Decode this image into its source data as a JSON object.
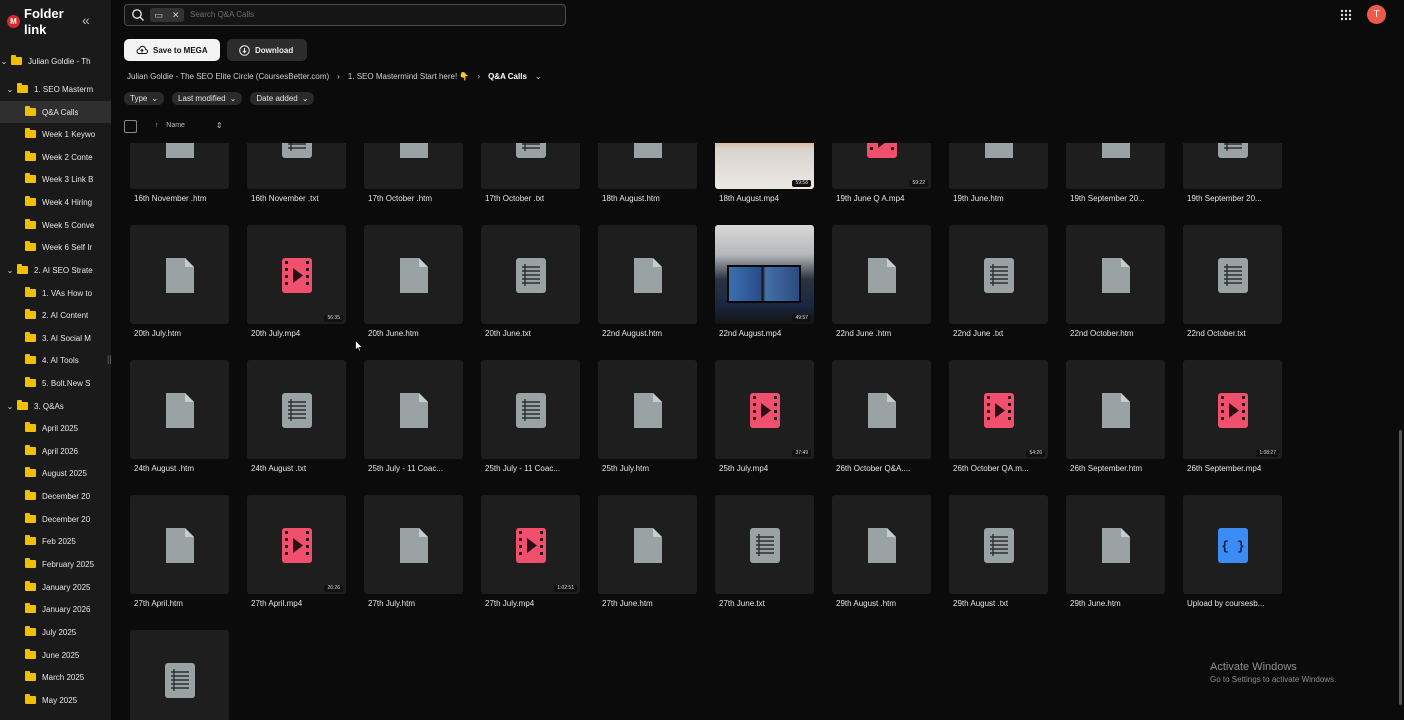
{
  "sidebar": {
    "logo_letter": "M",
    "title": "Folder link",
    "collapse_icon": "chevrons-left-icon",
    "tree": [
      {
        "label": "Julian Goldie - Th",
        "level": 0,
        "expanded": true
      },
      {
        "label": "1. SEO Masterm",
        "level": 1,
        "expanded": true
      },
      {
        "label": "Q&A Calls",
        "level": 2,
        "selected": true
      },
      {
        "label": "Week 1 Keywo",
        "level": 2
      },
      {
        "label": "Week 2 Conte",
        "level": 2
      },
      {
        "label": "Week 3 Link B",
        "level": 2
      },
      {
        "label": "Week 4 Hiring",
        "level": 2
      },
      {
        "label": "Week 5 Conve",
        "level": 2
      },
      {
        "label": "Week 6 Self Ir",
        "level": 2
      },
      {
        "label": "2. AI SEO Strate",
        "level": 1,
        "expanded": true
      },
      {
        "label": "1. VAs How to",
        "level": 2
      },
      {
        "label": "2. AI Content",
        "level": 2
      },
      {
        "label": "3. AI Social M",
        "level": 2
      },
      {
        "label": "4. AI Tools",
        "level": 2
      },
      {
        "label": "5. Bolt.New S",
        "level": 2
      },
      {
        "label": "3. Q&As",
        "level": 1,
        "expanded": true
      },
      {
        "label": "April 2025",
        "level": 2
      },
      {
        "label": "April 2026",
        "level": 2
      },
      {
        "label": "August 2025",
        "level": 2
      },
      {
        "label": "December 20",
        "level": 2
      },
      {
        "label": "December 20",
        "level": 2
      },
      {
        "label": "Feb 2025",
        "level": 2
      },
      {
        "label": "February 2025",
        "level": 2
      },
      {
        "label": "January 2025",
        "level": 2
      },
      {
        "label": "January 2026",
        "level": 2
      },
      {
        "label": "July 2025",
        "level": 2
      },
      {
        "label": "June 2025",
        "level": 2
      },
      {
        "label": "March 2025",
        "level": 2
      },
      {
        "label": "May 2025",
        "level": 2
      }
    ]
  },
  "search": {
    "placeholder": "Search Q&A Calls",
    "icon": "search-icon"
  },
  "header": {
    "avatar_letter": "T",
    "apps_icon": "grid-dots-icon"
  },
  "toolbar": {
    "save_label": "Save to MEGA",
    "download_label": "Download"
  },
  "breadcrumb": {
    "items": [
      "Julian Goldie - The SEO Elite Circle (CoursesBetter.com)",
      "1. SEO Mastermind Start here! 👇"
    ],
    "current": "Q&A Calls"
  },
  "filters": [
    "Type",
    "Last modified",
    "Date added"
  ],
  "list_header": {
    "name_label": "Name"
  },
  "files": [
    {
      "name": "16th November .htm",
      "kind": "doc"
    },
    {
      "name": "16th November .txt",
      "kind": "txt"
    },
    {
      "name": "17th October .htm",
      "kind": "doc"
    },
    {
      "name": "17th October .txt",
      "kind": "txt"
    },
    {
      "name": "18th August.htm",
      "kind": "doc"
    },
    {
      "name": "18th August.mp4",
      "kind": "thumb-umbrella",
      "duration": "59:58"
    },
    {
      "name": "19th June Q A.mp4",
      "kind": "video",
      "duration": "59:22"
    },
    {
      "name": "19th June.htm",
      "kind": "doc"
    },
    {
      "name": "19th September 20...",
      "kind": "doc"
    },
    {
      "name": "19th September 20...",
      "kind": "txt"
    },
    {
      "name": "20th July.htm",
      "kind": "doc"
    },
    {
      "name": "20th July.mp4",
      "kind": "video",
      "duration": "56:35"
    },
    {
      "name": "20th June.htm",
      "kind": "doc"
    },
    {
      "name": "20th June.txt",
      "kind": "txt"
    },
    {
      "name": "22nd August.htm",
      "kind": "doc"
    },
    {
      "name": "22nd August.mp4",
      "kind": "thumb-monitor",
      "duration": "49:57"
    },
    {
      "name": "22nd June .htm",
      "kind": "doc"
    },
    {
      "name": "22nd June .txt",
      "kind": "txt"
    },
    {
      "name": "22nd October.htm",
      "kind": "doc"
    },
    {
      "name": "22nd October.txt",
      "kind": "txt"
    },
    {
      "name": "24th August .htm",
      "kind": "doc"
    },
    {
      "name": "24th August .txt",
      "kind": "txt"
    },
    {
      "name": "25th July - 11 Coac...",
      "kind": "doc"
    },
    {
      "name": "25th July - 11 Coac...",
      "kind": "txt"
    },
    {
      "name": "25th July.htm",
      "kind": "doc"
    },
    {
      "name": "25th July.mp4",
      "kind": "video",
      "duration": "37:49"
    },
    {
      "name": "26th October Q&A....",
      "kind": "doc"
    },
    {
      "name": "26th October QA.m...",
      "kind": "video",
      "duration": "54:26"
    },
    {
      "name": "26th September.htm",
      "kind": "doc"
    },
    {
      "name": "26th September.mp4",
      "kind": "video",
      "duration": "1:08:27"
    },
    {
      "name": "27th April.htm",
      "kind": "doc"
    },
    {
      "name": "27th April.mp4",
      "kind": "video",
      "duration": "26:26"
    },
    {
      "name": "27th July.htm",
      "kind": "doc"
    },
    {
      "name": "27th July.mp4",
      "kind": "video",
      "duration": "1:02:51"
    },
    {
      "name": "27th June.htm",
      "kind": "doc"
    },
    {
      "name": "27th June.txt",
      "kind": "txt"
    },
    {
      "name": "29th August .htm",
      "kind": "doc"
    },
    {
      "name": "29th August .txt",
      "kind": "txt"
    },
    {
      "name": "29th June.htm",
      "kind": "doc"
    },
    {
      "name": "Upload by coursesb...",
      "kind": "code"
    },
    {
      "name": "",
      "kind": "txt"
    }
  ],
  "watermark": {
    "title": "Activate Windows",
    "subtitle": "Go to Settings to activate Windows."
  },
  "colors": {
    "video": "#f0506e",
    "doc": "#9aa3a3",
    "folder": "#f0c000",
    "code": "#3b8cf5",
    "accent": "#d9272e"
  }
}
